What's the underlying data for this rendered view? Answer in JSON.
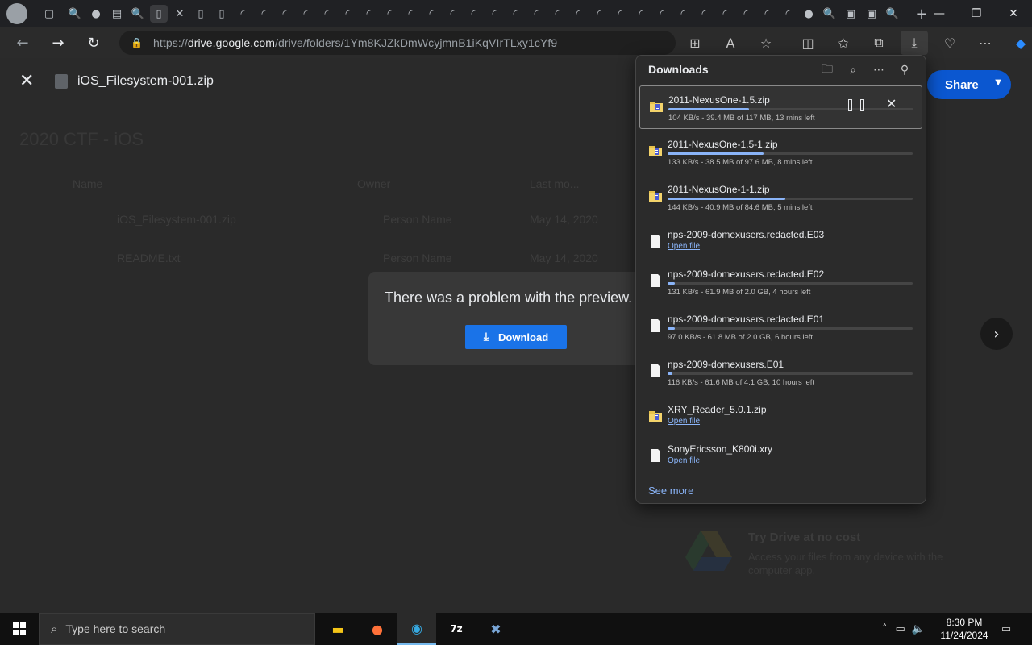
{
  "browser": {
    "url_prefix": "https://",
    "url_domain": "drive.google.com",
    "url_path": "/drive/folders/1Ym8KJZkDmWcyjmnB1iKqVIrTLxy1cYf9"
  },
  "preview": {
    "file_title": "iOS_Filesystem-001.zip",
    "share_label": "Share",
    "problem_message": "There was a problem with the preview.",
    "download_label": "Download"
  },
  "background_page": {
    "folder_title": "2020 CTF - iOS",
    "col_name": "Name",
    "col_owner": "Owner",
    "col_modified": "Last mo...",
    "row1_name": "iOS_Filesystem-001.zip",
    "row1_owner": "Person Name",
    "row1_date": "May 14, 2020",
    "row2_name": "README.txt",
    "row2_owner": "Person Name",
    "row2_date": "May 14, 2020",
    "promo_title": "Try Drive at no cost",
    "promo_sub": "Access your files from any device with the computer app."
  },
  "downloads": {
    "title": "Downloads",
    "see_more": "See more",
    "items": [
      {
        "name": "2011-NexusOne-1.5.zip",
        "status": "104 KB/s - 39.4 MB of 117 MB, 13 mins left",
        "progress": 0.33,
        "type": "zip"
      },
      {
        "name": "2011-NexusOne-1.5-1.zip",
        "status": "133 KB/s - 38.5 MB of 97.6 MB, 8 mins left",
        "progress": 0.39,
        "type": "zip"
      },
      {
        "name": "2011-NexusOne-1-1.zip",
        "status": "144 KB/s - 40.9 MB of 84.6 MB, 5 mins left",
        "progress": 0.48,
        "type": "zip"
      },
      {
        "name": "nps-2009-domexusers.redacted.E03",
        "link": "Open file",
        "type": "file"
      },
      {
        "name": "nps-2009-domexusers.redacted.E02",
        "status": "131 KB/s - 61.9 MB of 2.0 GB, 4 hours left",
        "progress": 0.03,
        "type": "file"
      },
      {
        "name": "nps-2009-domexusers.redacted.E01",
        "status": "97.0 KB/s - 61.8 MB of 2.0 GB, 6 hours left",
        "progress": 0.03,
        "type": "file"
      },
      {
        "name": "nps-2009-domexusers.E01",
        "status": "116 KB/s - 61.6 MB of 4.1 GB, 10 hours left",
        "progress": 0.015,
        "type": "file"
      },
      {
        "name": "XRY_Reader_5.0.1.zip",
        "link": "Open file",
        "type": "zip"
      },
      {
        "name": "SonyEricsson_K800i.xry",
        "link": "Open file",
        "type": "file"
      }
    ]
  },
  "taskbar": {
    "search_placeholder": "Type here to search",
    "time": "8:30 PM",
    "date": "11/24/2024"
  },
  "colors": {
    "accent_blue": "#8ab4f8",
    "share_blue": "#0b57d0",
    "download_button": "#1a73e8"
  }
}
